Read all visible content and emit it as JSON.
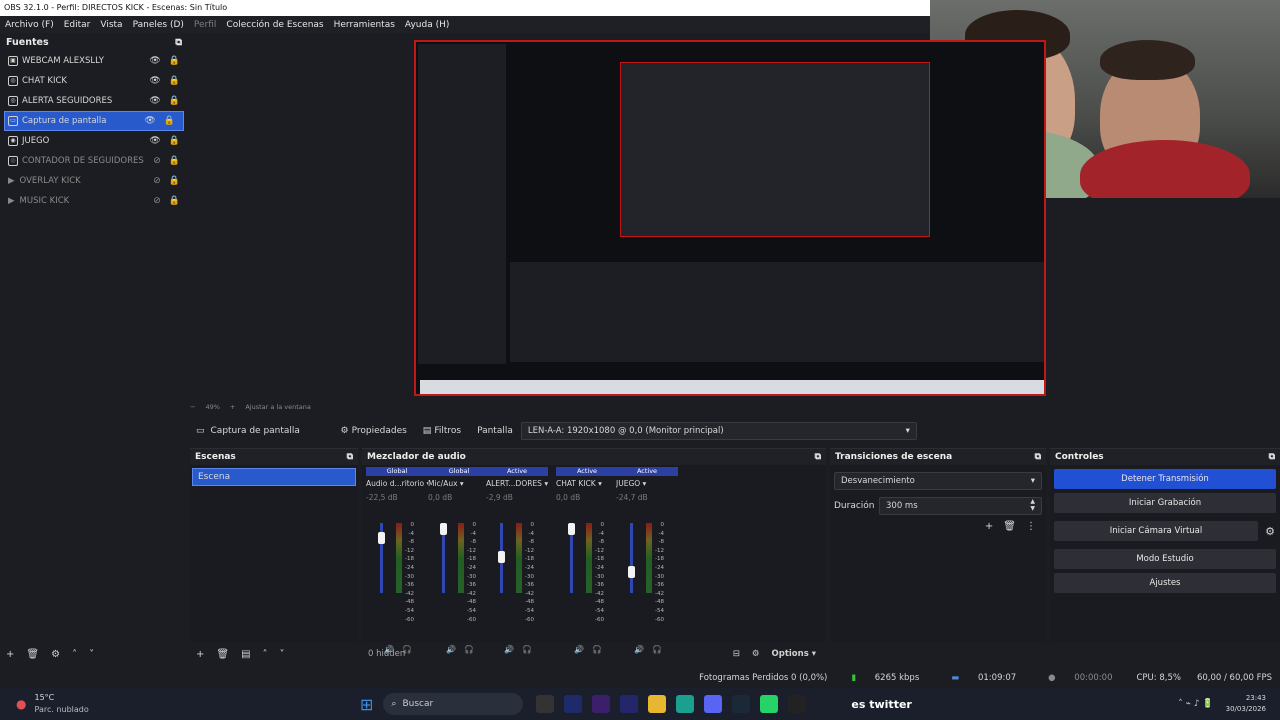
{
  "window": {
    "title": "OBS 32.1.0 - Perfil: DIRECTOS KICK - Escenas: Sin Título"
  },
  "menu": [
    "Archivo (F)",
    "Editar",
    "Vista",
    "Paneles (D)",
    "Perfil",
    "Colección de Escenas",
    "Herramientas",
    "Ayuda (H)"
  ],
  "sources": {
    "title": "Fuentes",
    "items": [
      {
        "label": "WEBCAM ALEXSLLY",
        "visible": true
      },
      {
        "label": "CHAT KICK",
        "visible": true
      },
      {
        "label": "ALERTA SEGUIDORES",
        "visible": true
      },
      {
        "label": "Captura de pantalla",
        "visible": true,
        "selected": true
      },
      {
        "label": "JUEGO",
        "visible": true
      },
      {
        "label": "CONTADOR DE SEGUIDORES",
        "visible": false
      },
      {
        "label": "OVERLAY KICK",
        "visible": false
      },
      {
        "label": "MUSIC KICK",
        "visible": false
      }
    ]
  },
  "zoom": {
    "value": "49%",
    "fit": "Ajustar a la ventana"
  },
  "context": {
    "source": "Captura de pantalla",
    "properties": "Propiedades",
    "filters": "Filtros",
    "label": "Pantalla",
    "monitor": "LEN-A-A: 1920x1080 @ 0,0 (Monitor principal)"
  },
  "scenes": {
    "title": "Escenas",
    "items": [
      "Escena"
    ]
  },
  "mixer": {
    "title": "Mezclador de audio",
    "channels": [
      {
        "tag": "Global",
        "name": "Audio d...ritorio",
        "db": "-22,5 dB",
        "level": 0.85
      },
      {
        "tag": "Global",
        "name": "Mic/Aux",
        "db": "0,0 dB",
        "level": 1.0
      },
      {
        "tag": "Active",
        "name": "ALERT...DORES",
        "db": "-2,9 dB",
        "level": 0.55
      },
      {
        "tag": "Active",
        "name": "CHAT KICK",
        "db": "0,0 dB",
        "level": 1.0
      },
      {
        "tag": "Active",
        "name": "JUEGO",
        "db": "-24,7 dB",
        "level": 0.3
      }
    ],
    "ticks": [
      "0",
      "-4",
      "-8",
      "-12",
      "-18",
      "-24",
      "-30",
      "-36",
      "-42",
      "-48",
      "-54",
      "-60"
    ],
    "hidden": "0 hidden",
    "options": "Options"
  },
  "transitions": {
    "title": "Transiciones de escena",
    "type": "Desvanecimiento",
    "duration_label": "Duración",
    "duration_value": "300 ms"
  },
  "controls": {
    "title": "Controles",
    "buttons": [
      "Detener Transmisión",
      "Iniciar Grabación",
      "Iniciar Cámara Virtual",
      "Modo Estudio",
      "Ajustes"
    ]
  },
  "status": {
    "dropped": "Fotogramas Perdidos 0 (0,0%)",
    "bitrate": "6265 kbps",
    "stream_time": "01:09:07",
    "rec_time": "00:00:00",
    "cpu": "CPU: 8,5%",
    "fps": "60,00 / 60,00 FPS"
  },
  "taskbar": {
    "temperature": "15°C",
    "weather": "Parc. nublado",
    "search": "Buscar",
    "clock": "23:43",
    "date": "30/03/2026",
    "overlay_text": "es twitter"
  },
  "colors": {
    "accent": "#2250d4",
    "selection": "#285acc",
    "record_border": "#c01818"
  }
}
